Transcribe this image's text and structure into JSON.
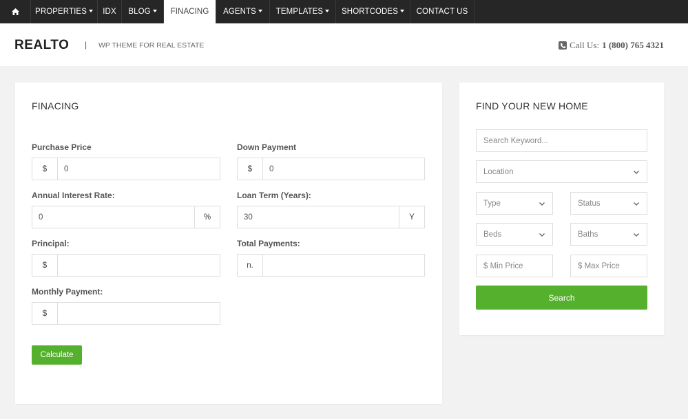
{
  "nav": {
    "home_icon": "home-icon",
    "items": [
      {
        "label": "PROPERTIES",
        "dropdown": true
      },
      {
        "label": "IDX",
        "dropdown": false
      },
      {
        "label": "BLOG",
        "dropdown": true
      },
      {
        "label": "FINACING",
        "dropdown": false,
        "active": true
      },
      {
        "label": "AGENTS",
        "dropdown": true
      },
      {
        "label": "TEMPLATES",
        "dropdown": true
      },
      {
        "label": "SHORTCODES",
        "dropdown": true
      },
      {
        "label": "CONTACT US",
        "dropdown": false
      }
    ]
  },
  "header": {
    "logo": "REALTO",
    "separator": "|",
    "tagline": "WP THEME FOR REAL ESTATE",
    "phone_prefix": "Call Us:",
    "phone_number": "1 (800) 765 4321",
    "phone_icon": "phone-icon"
  },
  "financing": {
    "title": "FINACING",
    "purchase_price": {
      "label": "Purchase Price",
      "addon": "$",
      "value": "0"
    },
    "down_payment": {
      "label": "Down Payment",
      "addon": "$",
      "value": "0"
    },
    "interest_rate": {
      "label": "Annual Interest Rate:",
      "addon": "%",
      "value": "0"
    },
    "loan_term": {
      "label": "Loan Term (Years):",
      "addon": "Y",
      "value": "30"
    },
    "principal": {
      "label": "Principal:",
      "addon": "$",
      "value": ""
    },
    "total_payments": {
      "label": "Total Payments:",
      "addon": "n.",
      "value": ""
    },
    "monthly_payment": {
      "label": "Monthly Payment:",
      "addon": "$",
      "value": ""
    },
    "calculate_label": "Calculate"
  },
  "search": {
    "title": "FIND YOUR NEW HOME",
    "keyword_placeholder": "Search Keyword...",
    "location": "Location",
    "type": "Type",
    "status": "Status",
    "beds": "Beds",
    "baths": "Baths",
    "min_price_placeholder": "$ Min Price",
    "max_price_placeholder": "$ Max Price",
    "search_label": "Search"
  },
  "colors": {
    "nav_bg": "#262626",
    "accent_green": "#55b02e",
    "page_bg": "#f2f2f2"
  }
}
